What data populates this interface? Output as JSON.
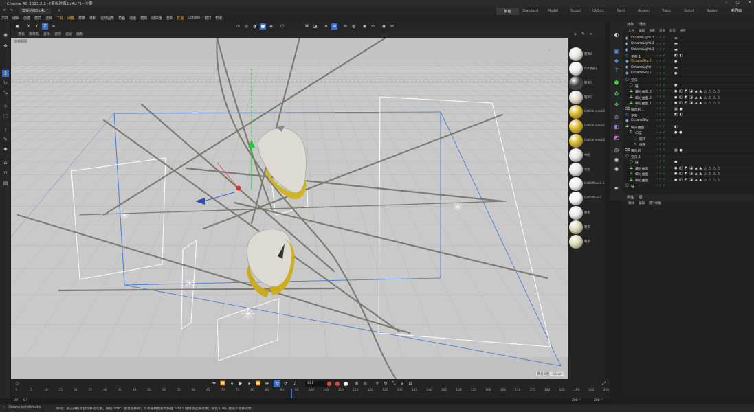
{
  "window": {
    "title": "Cinema 4D 2023.2.1 - [篮板封面3.c4d *] - 主要",
    "controls": [
      "–",
      "▢",
      "✕"
    ]
  },
  "tabs": {
    "document": "篮板封面3.c4d *",
    "layouts": [
      "启动",
      "Standard",
      "Model",
      "Sculpt",
      "UVEdit",
      "Paint",
      "Groom",
      "Track",
      "Script",
      "Nodes"
    ],
    "active_layout": "启动",
    "new_ui": "新界面"
  },
  "menu": [
    "文件",
    "编辑",
    "创建",
    "模式",
    "选择",
    "工具",
    "网格",
    "样条",
    "体积",
    "运动图形",
    "角色",
    "动画",
    "模拟",
    "跟踪器",
    "渲染",
    "扩展",
    "Octane",
    "窗口",
    "帮助"
  ],
  "menu_highlight": [
    "工具",
    "网格",
    "扩展"
  ],
  "vp_toolbar": [
    "X",
    "Y",
    "Z"
  ],
  "viewport": {
    "label": "透视视图",
    "grid_info": "网格间距 : 50 cm",
    "menu": [
      "查看",
      "摄像机",
      "显示",
      "选项",
      "过滤",
      "面板"
    ]
  },
  "materials": [
    {
      "name": "鞋带2",
      "color": "#e8e6df"
    },
    {
      "name": "Oct黑胶1",
      "color": "#eeeeee"
    },
    {
      "name": "鞋带1",
      "color": "#3a3a3a"
    },
    {
      "name": "鞋带1",
      "color": "#dcd6c4"
    },
    {
      "name": "OctUniversal1",
      "color": "#d4b21e"
    },
    {
      "name": "OctUniversal1",
      "color": "#d4b21e"
    },
    {
      "name": "OctUniversal1",
      "color": "#d4b21e"
    },
    {
      "name": "中底",
      "color": "#e4e4e4"
    },
    {
      "name": "大底",
      "color": "#e2e2e2"
    },
    {
      "name": "OctDiffuse1.1",
      "color": "#eeeeee"
    },
    {
      "name": "OctDiffuse1",
      "color": "#f4f4f4"
    },
    {
      "name": "鞋带",
      "color": "#e7e7e7"
    },
    {
      "name": "鞋带",
      "color": "#d8d3b3"
    },
    {
      "name": "鞋带",
      "color": "#dcd6ae"
    }
  ],
  "object_manager": {
    "tabs": [
      "对象",
      "场次"
    ],
    "menu": [
      "文件",
      "编辑",
      "查看",
      "对象",
      "标签",
      "书签"
    ],
    "objects": [
      {
        "name": "OctaneLight.3",
        "indent": 0,
        "icon": "light",
        "tags": "▬",
        "y": false
      },
      {
        "name": "OctaneLight.2",
        "indent": 0,
        "icon": "light",
        "tags": "▬",
        "y": false
      },
      {
        "name": "OctaneLight.1",
        "indent": 0,
        "icon": "light",
        "tags": "▬",
        "y": false
      },
      {
        "name": "平面.1",
        "indent": 0,
        "icon": "plane",
        "tags": "◩ ◧",
        "y": false
      },
      {
        "name": "OctaneSky.2",
        "indent": 0,
        "icon": "sky",
        "tags": "●",
        "y": true
      },
      {
        "name": "OctaneLight",
        "indent": 0,
        "icon": "light",
        "tags": "▬",
        "y": false
      },
      {
        "name": "OctaneSky.1",
        "indent": 0,
        "icon": "sky",
        "tags": "●",
        "y": false
      },
      {
        "name": "空白",
        "indent": 0,
        "icon": "null",
        "tags": "",
        "y": false
      },
      {
        "name": "鞋",
        "indent": 1,
        "icon": "null",
        "tags": "●",
        "y": false
      },
      {
        "name": "细分曲面.3",
        "indent": 1,
        "icon": "sds",
        "tags": "● ◧ ◩ ◪ ▲ ▲ △ △ △ △",
        "y": false
      },
      {
        "name": "细分曲面.2",
        "indent": 1,
        "icon": "sds",
        "tags": "● ◧ ◩ ◪ ▲ ▲ △ △ △ △",
        "y": false
      },
      {
        "name": "细分曲面.1",
        "indent": 1,
        "icon": "sds",
        "tags": "● ◧ ◩ ◪ ▲ ▲ △ △ △ △",
        "y": false
      },
      {
        "name": "摄像机.1",
        "indent": 0,
        "icon": "cam",
        "tags": "▦ ●",
        "y": false
      },
      {
        "name": "平面",
        "indent": 0,
        "icon": "plane",
        "tags": "◩ ◧",
        "y": false
      },
      {
        "name": "OctaneSky",
        "indent": 0,
        "icon": "sky",
        "tags": "",
        "y": false
      },
      {
        "name": "细分曲面",
        "indent": 0,
        "icon": "sds",
        "tags": "◧",
        "y": false
      },
      {
        "name": "扫描",
        "indent": 1,
        "icon": "sweep",
        "tags": "● ●",
        "y": false
      },
      {
        "name": "圆环",
        "indent": 2,
        "icon": "circle",
        "tags": "",
        "y": false
      },
      {
        "name": "样条",
        "indent": 2,
        "icon": "spline",
        "tags": "",
        "y": false
      },
      {
        "name": "摄像机",
        "indent": 0,
        "icon": "cam",
        "tags": "▦ ●",
        "y": false
      },
      {
        "name": "空白.1",
        "indent": 0,
        "icon": "null",
        "tags": "",
        "y": false
      },
      {
        "name": "鞋",
        "indent": 1,
        "icon": "null",
        "tags": "●",
        "y": false
      },
      {
        "name": "细分曲面",
        "indent": 1,
        "icon": "sds",
        "tags": "● ◧ ◩ ◪ ▲ ▲ △ △ △ △",
        "y": false
      },
      {
        "name": "细分曲面",
        "indent": 1,
        "icon": "sds",
        "tags": "● ◧ ◩ ◪ ▲ ▲ △ △ △ △",
        "y": false
      },
      {
        "name": "细分曲面",
        "indent": 1,
        "icon": "sds",
        "tags": "● ◧ ◩ ◪ ▲ ▲ △ △ △ △",
        "y": false
      },
      {
        "name": "鞋",
        "indent": 0,
        "icon": "null",
        "tags": "",
        "y": false
      }
    ]
  },
  "attributes": {
    "tabs": [
      "属性",
      "层"
    ],
    "menu": [
      "模式",
      "编辑",
      "用户数据"
    ]
  },
  "timeline": {
    "current_frame": "93 F",
    "start": "0 F",
    "end": "200 F",
    "end2": "200 F",
    "ticks": [
      0,
      5,
      10,
      15,
      20,
      25,
      30,
      35,
      40,
      45,
      50,
      55,
      60,
      65,
      70,
      75,
      80,
      85,
      90,
      95,
      100,
      105,
      110,
      115,
      120,
      125,
      130,
      135,
      140,
      145,
      150,
      155,
      160,
      165,
      170,
      175,
      180,
      185,
      190,
      195,
      200
    ],
    "playhead": 93,
    "range_start": "0 F",
    "range_left": "0 F"
  },
  "status": {
    "left": "Octane:init defaults",
    "message": "移动：点击并拖动鼠标移动元素。按住 SHIFT 键量化移动；节点编辑模式时按住 SHIFT 键增加选择对象；按住 CTRL 键减少选择对象。"
  }
}
